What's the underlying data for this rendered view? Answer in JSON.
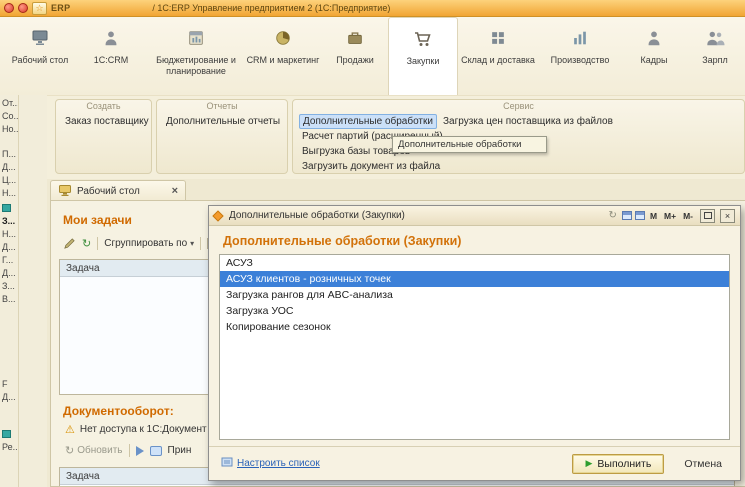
{
  "icons": {
    "star": "☆",
    "close": "×",
    "caret_down": "▾",
    "play": "▶",
    "warning": "⚠",
    "refresh": "↻"
  },
  "titlebar": {
    "brand": "ERP",
    "title": "/ 1С:ERP Управление предприятием 2 (1С:Предприятие)"
  },
  "ribbon": {
    "active_tab": "Закупки",
    "tabs": [
      {
        "label": "Рабочий стол"
      },
      {
        "label": "1С:CRM"
      },
      {
        "label": "Бюджетирование и планирование"
      },
      {
        "label": "CRM и маркетинг"
      },
      {
        "label": "Продажи"
      },
      {
        "label": "Закупки"
      },
      {
        "label": "Склад и доставка"
      },
      {
        "label": "Производство"
      },
      {
        "label": "Кадры"
      },
      {
        "label": "Зарпл"
      }
    ]
  },
  "action_panel": {
    "groups": [
      {
        "title": "Создать",
        "items": [
          "Заказ поставщику"
        ]
      },
      {
        "title": "Отчеты",
        "items": [
          "Дополнительные отчеты"
        ]
      },
      {
        "title": "Сервис",
        "items_left": [
          "Дополнительные обработки",
          "Расчет партий (расширенный)",
          "Выгрузка базы товаров",
          "Загрузить документ из файла"
        ],
        "items_right": [
          "Загрузка цен поставщика из файлов"
        ],
        "highlighted_item": "Дополнительные обработки"
      }
    ],
    "tooltip": "Дополнительные обработки"
  },
  "sidebar": {
    "items": [
      "От...",
      "Со...",
      "Но...",
      "П...",
      "Д...",
      "Ц...",
      "Н...",
      "З...",
      "Н...",
      "Д...",
      "Г...",
      "Д...",
      "З...",
      "В...",
      "F",
      "Д...",
      "Ре..."
    ]
  },
  "workspace": {
    "tab_label": "Рабочий стол",
    "my_tasks": {
      "title": "Мои задачи",
      "group_by_label": "Сгруппировать по",
      "column_header": "Задача"
    },
    "docflow": {
      "title": "Документооборот:",
      "warning": "Нет доступа к 1С:Документ",
      "refresh_label": "Обновить",
      "accept_label": "Прин",
      "column_header": "Задача"
    }
  },
  "dialog": {
    "title": "Дополнительные обработки (Закупки)",
    "heading": "Дополнительные обработки (Закупки)",
    "scale_buttons": [
      "М",
      "М+",
      "М-"
    ],
    "items": [
      "АСУЗ",
      "АСУЗ клиентов - розничных точек",
      "Загрузка рангов для ABC-анализа",
      "Загрузка УОС",
      "Копирование сезонок"
    ],
    "selected_item": "АСУЗ клиентов - розничных точек",
    "footer": {
      "configure_link": "Настроить список",
      "run_label": "Выполнить",
      "cancel_label": "Отмена"
    }
  },
  "colors": {
    "accent_orange": "#d2720a",
    "selection_blue": "#3c80d8",
    "highlight_blue_bg": "#cbe0f8",
    "titlebar_orange": "#f1a534"
  }
}
